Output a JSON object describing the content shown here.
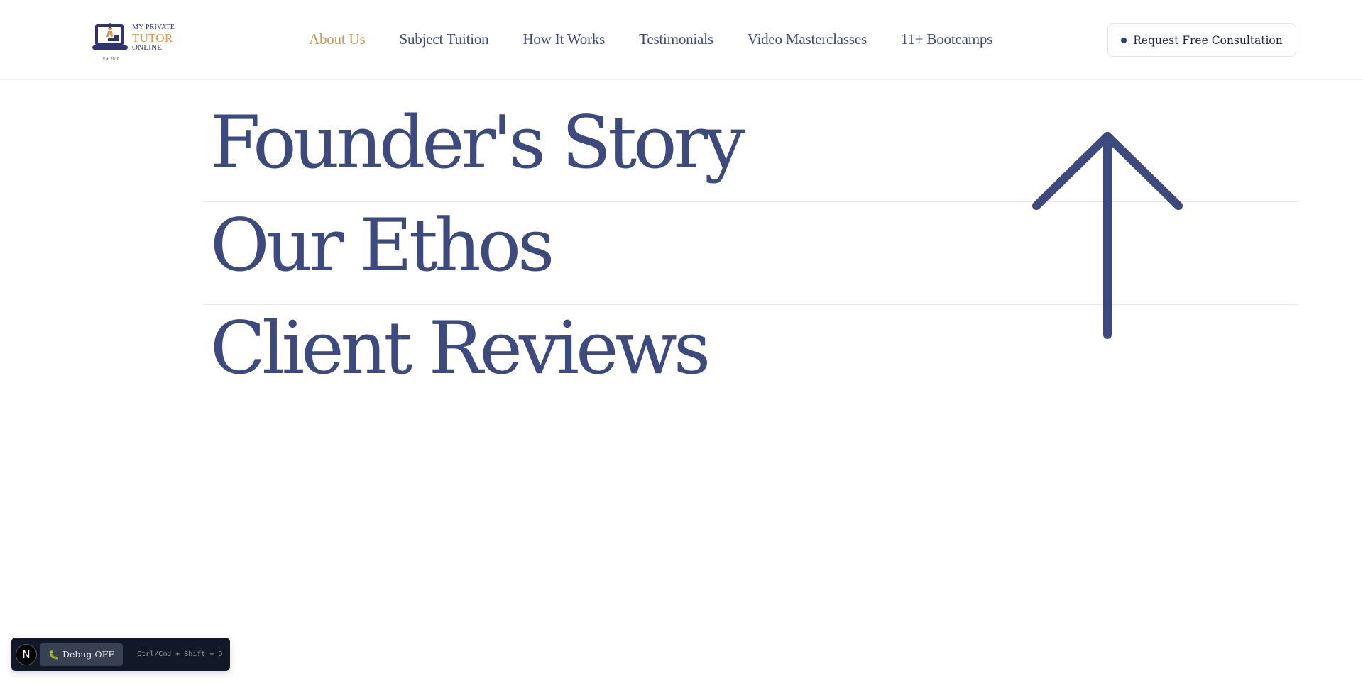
{
  "brand": {
    "line1": "MY PRIVATE",
    "line2": "TUTOR",
    "line3": "ONLINE",
    "est": "Est. 2010",
    "colors": {
      "navy": "#2f3371",
      "gold": "#d59a4c"
    }
  },
  "nav": {
    "items": [
      {
        "label": "About Us",
        "active": true
      },
      {
        "label": "Subject Tuition",
        "active": false
      },
      {
        "label": "How It Works",
        "active": false
      },
      {
        "label": "Testimonials",
        "active": false
      },
      {
        "label": "Video Masterclasses",
        "active": false
      },
      {
        "label": "11+ Bootcamps",
        "active": false
      }
    ],
    "active_color": "#c99a5b",
    "text_color": "#3d4a7e"
  },
  "cta": {
    "label": "Request Free Consultation"
  },
  "menu": {
    "items": [
      {
        "label": "Founder's Story"
      },
      {
        "label": "Our Ethos"
      },
      {
        "label": "Client Reviews"
      }
    ],
    "text_color": "#3d4a7f",
    "arrow_icon": "arrow-up-icon"
  },
  "debug": {
    "badge": "N",
    "button_label": "Debug OFF",
    "shortcut_hint": "Ctrl/Cmd + Shift + D"
  }
}
